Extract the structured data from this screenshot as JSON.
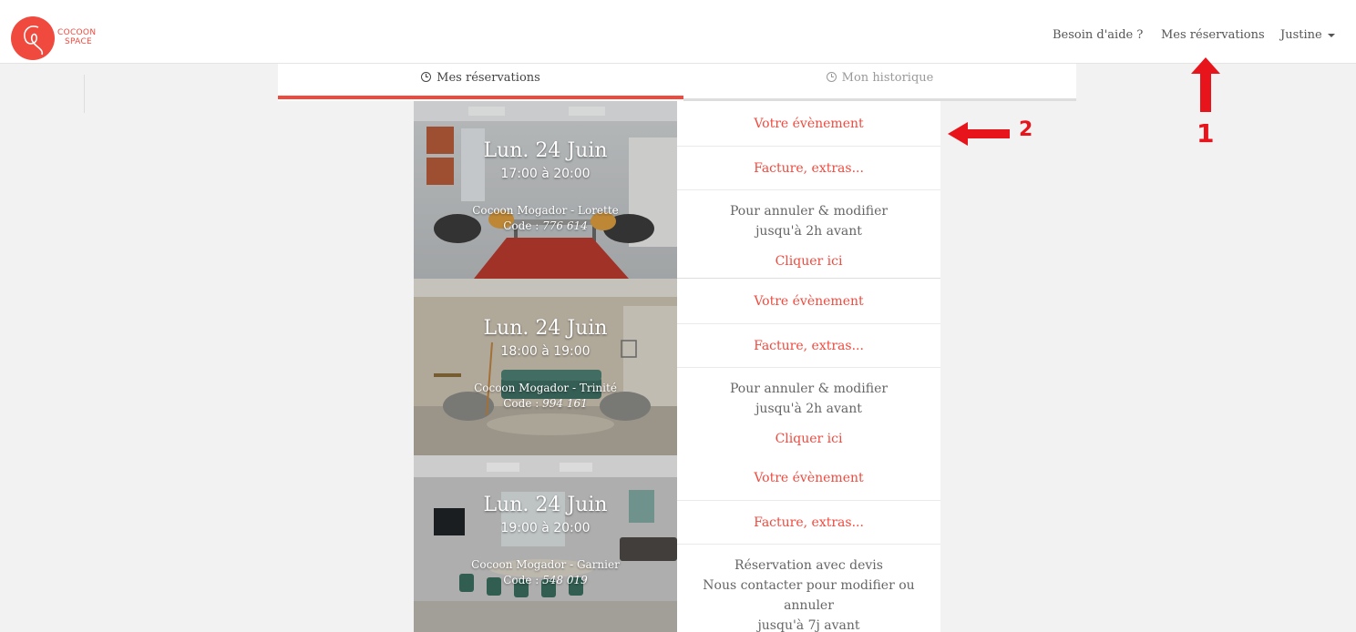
{
  "header": {
    "logo_line1": "COCOON",
    "logo_line2": "SPACE",
    "nav_help": "Besoin d'aide ?",
    "nav_reservations": "Mes réservations",
    "nav_user": "Justine"
  },
  "tabs": {
    "active": "Mes réservations",
    "history": "Mon historique"
  },
  "bookings": [
    {
      "date": "Lun. 24 Juin",
      "time": "17:00 à 20:00",
      "room": "Cocoon Mogador - Lorette",
      "code_label": "Code :",
      "code": "776 614",
      "event_link": "Votre évènement",
      "invoice_link": "Facture, extras...",
      "policy_line1": "Pour annuler & modifier",
      "policy_line2": "jusqu'à 2h avant",
      "policy_line3": "",
      "action_link": "Cliquer ici"
    },
    {
      "date": "Lun. 24 Juin",
      "time": "18:00 à 19:00",
      "room": "Cocoon Mogador - Trinité",
      "code_label": "Code :",
      "code": "994 161",
      "event_link": "Votre évènement",
      "invoice_link": "Facture, extras...",
      "policy_line1": "Pour annuler & modifier",
      "policy_line2": "jusqu'à 2h avant",
      "policy_line3": "",
      "action_link": "Cliquer ici"
    },
    {
      "date": "Lun. 24 Juin",
      "time": "19:00 à 20:00",
      "room": "Cocoon Mogador - Garnier",
      "code_label": "Code :",
      "code": "548 019",
      "event_link": "Votre évènement",
      "invoice_link": "Facture, extras...",
      "policy_line1": "Réservation avec devis",
      "policy_line2": "Nous contacter pour modifier ou annuler",
      "policy_line3": "jusqu'à 7j avant",
      "action_link": ""
    }
  ],
  "annotations": {
    "marker_1": "1",
    "marker_2": "2",
    "color": "#e8141c"
  },
  "colors": {
    "accent": "#f04a3e",
    "background": "#f2f2f2"
  }
}
